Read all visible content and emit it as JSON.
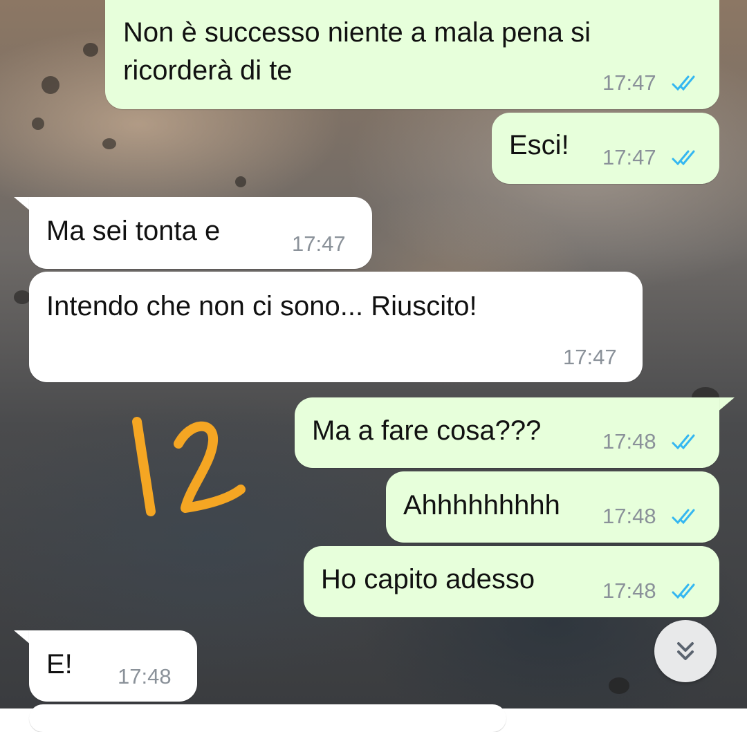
{
  "messages": [
    {
      "direction": "outgoing",
      "text_line1": "Non è successo niente a mala pena si",
      "text_line2": "ricorderà di te",
      "time": "17:47",
      "status": "read"
    },
    {
      "direction": "outgoing",
      "text": "Esci!",
      "time": "17:47",
      "status": "read"
    },
    {
      "direction": "incoming",
      "text": "Ma sei tonta e",
      "time": "17:47"
    },
    {
      "direction": "incoming",
      "text": "Intendo che non ci sono... Riuscito!",
      "time": "17:47"
    },
    {
      "direction": "outgoing",
      "text": "Ma a fare cosa???",
      "time": "17:48",
      "status": "read"
    },
    {
      "direction": "outgoing",
      "text": "Ahhhhhhhhh",
      "time": "17:48",
      "status": "read"
    },
    {
      "direction": "outgoing",
      "text": "Ho capito adesso",
      "time": "17:48",
      "status": "read"
    },
    {
      "direction": "incoming",
      "text": "E!",
      "time": "17:48"
    }
  ],
  "annotation": {
    "text": "12",
    "color": "#f5a623"
  },
  "colors": {
    "outgoing_bubble": "#e7ffdb",
    "incoming_bubble": "#ffffff",
    "read_ticks": "#34b7f1",
    "timestamp": "#8a9199"
  },
  "icons": {
    "read_receipt": "double-check-icon",
    "scroll_down": "chevron-double-down-icon"
  }
}
